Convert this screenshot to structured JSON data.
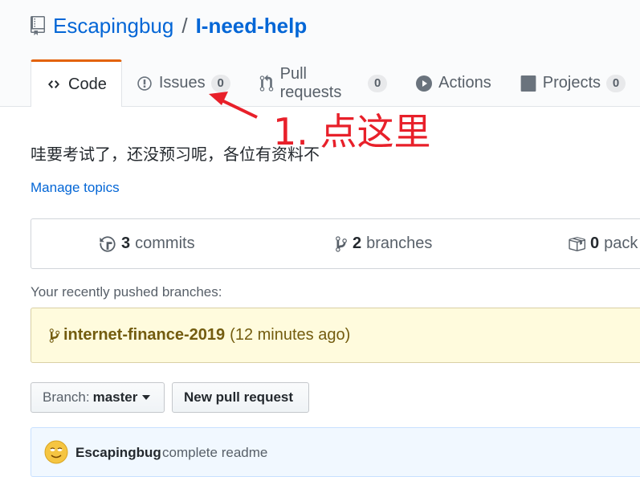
{
  "repo": {
    "owner": "Escapingbug",
    "separator": "/",
    "name": "I-need-help"
  },
  "tabs": [
    {
      "label": "Code",
      "icon": "code-icon",
      "selected": true
    },
    {
      "label": "Issues",
      "icon": "issue-opened-icon",
      "count": "0"
    },
    {
      "label": "Pull requests",
      "icon": "git-pull-request-icon",
      "count": "0"
    },
    {
      "label": "Actions",
      "icon": "play-icon"
    },
    {
      "label": "Projects",
      "icon": "project-icon",
      "count": "0"
    }
  ],
  "annotation": {
    "text": "1. 点这里",
    "color": "#e8202a"
  },
  "description": "哇要考试了，还没预习呢，各位有资料不",
  "manage_topics": "Manage topics",
  "summary": {
    "commits": {
      "count": "3",
      "label": "commits"
    },
    "branches": {
      "count": "2",
      "label": "branches"
    },
    "packages": {
      "count": "0",
      "label": "pack"
    }
  },
  "recent": {
    "label": "Your recently pushed branches:",
    "branch": "internet-finance-2019",
    "time": "(12 minutes ago)"
  },
  "branch_button": {
    "label": "Branch:",
    "value": "master"
  },
  "new_pr_button": "New pull request",
  "commit": {
    "author": "Escapingbug",
    "message": "complete readme"
  },
  "colors": {
    "link": "#0366d6",
    "selected_tab_accent": "#e36209",
    "recent_bg": "#fffbdd",
    "commit_bg": "#f1f8ff"
  }
}
